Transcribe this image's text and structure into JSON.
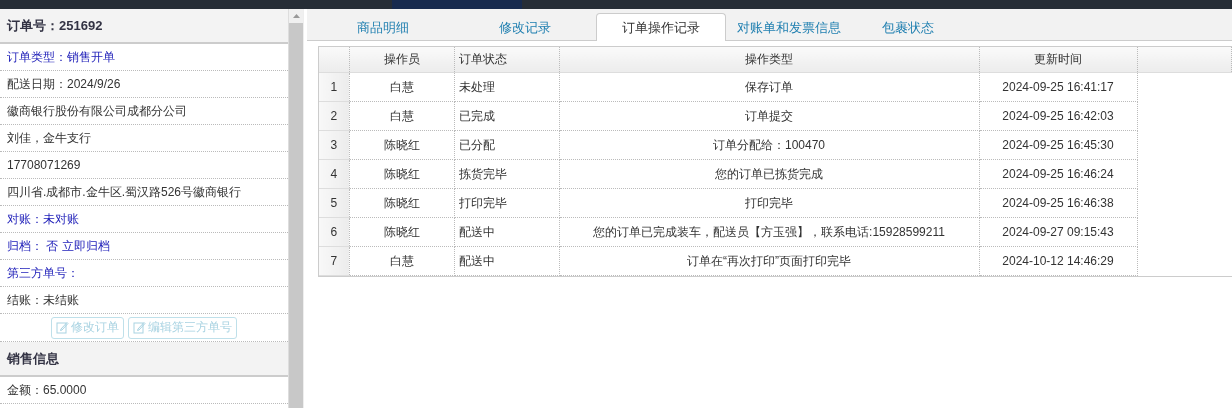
{
  "order_panel": {
    "title": "订单号：251692",
    "fields": [
      {
        "text": "订单类型：销售开单",
        "kind": "link"
      },
      {
        "text": "配送日期：2024/9/26",
        "kind": "plain"
      },
      {
        "text": "徽商银行股份有限公司成都分公司",
        "kind": "plain"
      },
      {
        "text": "刘佳，金牛支行",
        "kind": "plain"
      },
      {
        "text": "17708071269",
        "kind": "plain"
      },
      {
        "text": "四川省.成都市.金牛区.蜀汉路526号徽商银行",
        "kind": "plain"
      },
      {
        "text": "对账：未对账",
        "kind": "link"
      },
      {
        "text": "归档： 否 立即归档",
        "kind": "link"
      },
      {
        "text": "第三方单号：",
        "kind": "link"
      },
      {
        "text": "结账：未结账",
        "kind": "plain"
      }
    ],
    "buttons": [
      {
        "label": "修改订单",
        "disabled": true
      },
      {
        "label": "编辑第三方单号",
        "disabled": true
      }
    ]
  },
  "sales_panel": {
    "title": "销售信息",
    "fields": [
      "金额：65.0000"
    ]
  },
  "tabs": [
    {
      "label": "商品明细",
      "selected": false
    },
    {
      "label": "修改记录",
      "selected": false
    },
    {
      "label": "订单操作记录",
      "selected": true
    },
    {
      "label": "对账单和发票信息",
      "selected": false
    },
    {
      "label": "包裹状态",
      "selected": false
    }
  ],
  "table": {
    "columns": [
      "",
      "操作员",
      "订单状态",
      "操作类型",
      "更新时间"
    ],
    "rows": [
      [
        "1",
        "白慧",
        "未处理",
        "保存订单",
        "2024-09-25 16:41:17"
      ],
      [
        "2",
        "白慧",
        "已完成",
        "订单提交",
        "2024-09-25 16:42:03"
      ],
      [
        "3",
        "陈晓红",
        "已分配",
        "订单分配给：100470",
        "2024-09-25 16:45:30"
      ],
      [
        "4",
        "陈晓红",
        "拣货完毕",
        "您的订单已拣货完成",
        "2024-09-25 16:46:24"
      ],
      [
        "5",
        "陈晓红",
        "打印完毕",
        "打印完毕",
        "2024-09-25 16:46:38"
      ],
      [
        "6",
        "陈晓红",
        "配送中",
        "您的订单已完成装车，配送员【方玉强】，联系电话:15928599211",
        "2024-09-27 09:15:43"
      ],
      [
        "7",
        "白慧",
        "配送中",
        "订单在“再次打印”页面打印完毕",
        "2024-10-12 14:46:29"
      ]
    ]
  }
}
